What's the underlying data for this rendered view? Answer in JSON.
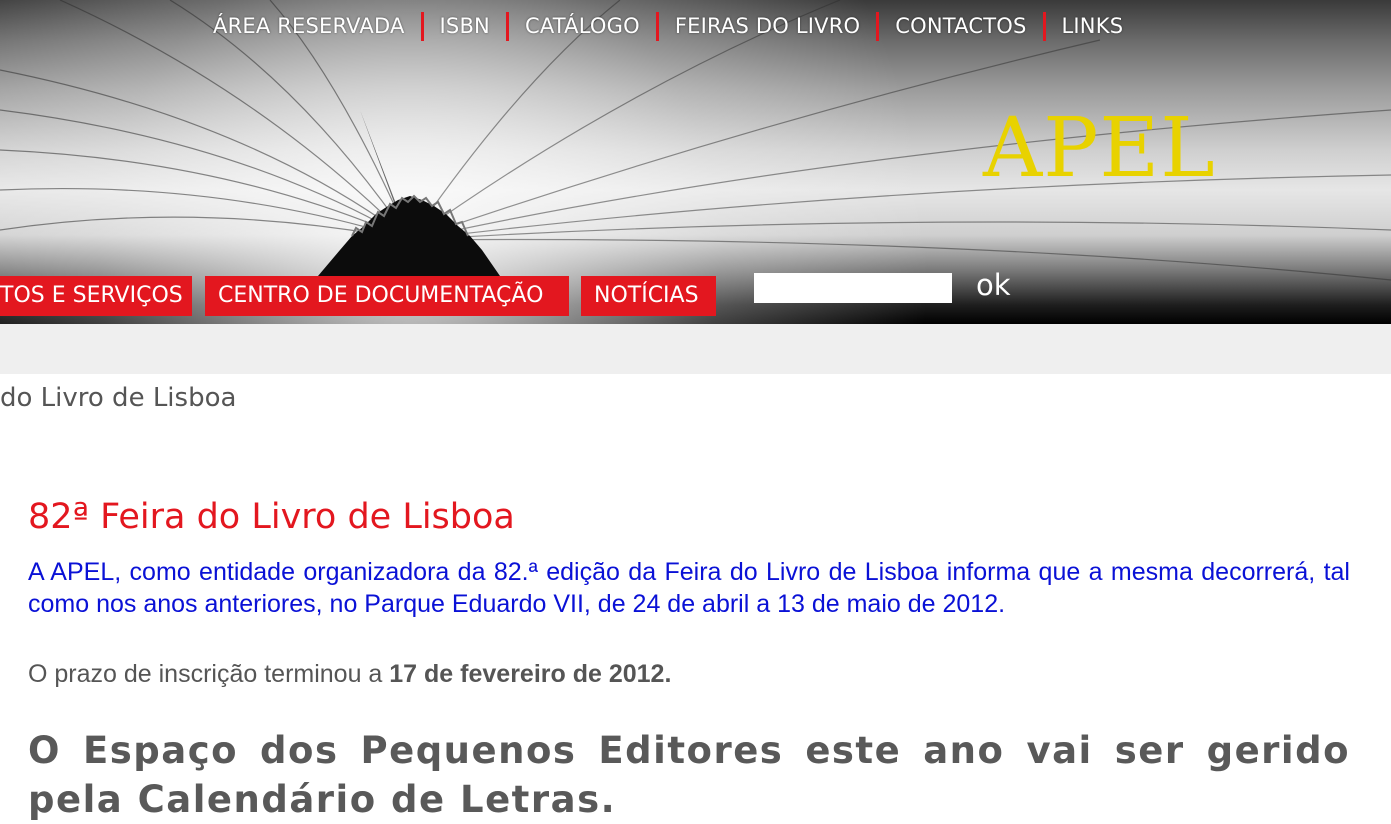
{
  "header": {
    "top_nav": [
      "ÁREA RESERVADA",
      "ISBN",
      "CATÁLOGO",
      "FEIRAS DO LIVRO",
      "CONTACTOS",
      "LINKS"
    ],
    "logo_text": "APEL",
    "main_nav": [
      "TOS E SERVIÇOS",
      "CENTRO DE DOCUMENTAÇÃO",
      "NOTÍCIAS"
    ],
    "search": {
      "value": "",
      "button_label": "ok"
    }
  },
  "breadcrumb": "do Livro de Lisboa",
  "article": {
    "title": "82ª Feira do Livro de Lisboa",
    "intro": "A APEL, como entidade organizadora da 82.ª edição da Feira do Livro de Lisboa informa que a mesma decorrerá, tal como nos anos anteriores, no Parque Eduardo VII, de 24 de abril a 13 de maio de 2012.",
    "deadline_prefix": "O prazo de inscrição terminou a ",
    "deadline_date": "17 de fevereiro de 2012.",
    "subheading": "O Espaço dos Pequenos Editores este ano vai ser gerido pela Calendário de Letras."
  },
  "colors": {
    "brand_red": "#e3171f",
    "logo_yellow": "#e8d200",
    "intro_blue": "#0a11d6",
    "text_gray": "#555555"
  },
  "icons": [
    "open-book-banner-image",
    "apel-logo"
  ]
}
